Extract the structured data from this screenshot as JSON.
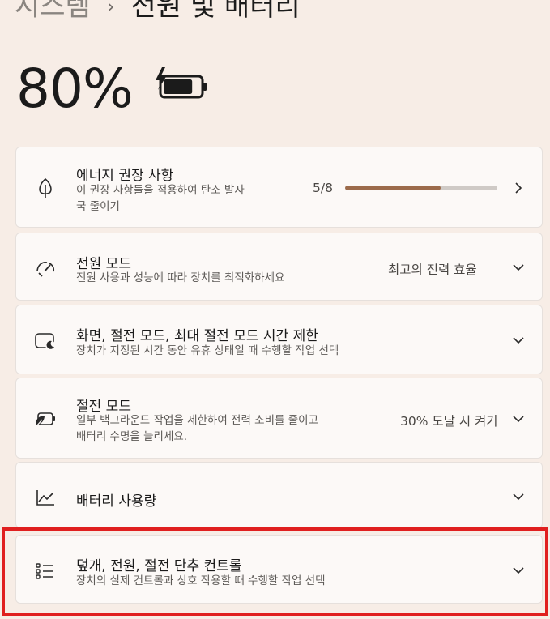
{
  "breadcrumb": {
    "parent": "시스템",
    "separator": "›",
    "current": "전원 및 배터리"
  },
  "battery": {
    "percent_text": "80%",
    "charging": true,
    "level": 0.8
  },
  "colors": {
    "accent": "#9c6b4b",
    "highlight": "#e01f1f",
    "background": "#f7ede6"
  },
  "cards": {
    "energy": {
      "title": "에너지 권장 사항",
      "desc_line1": "이 권장 사항들을 적용하여 탄소 발자",
      "desc_line2": "국 줄이기",
      "progress_text": "5/8",
      "progress_fraction": 0.625,
      "icon": "leaf-icon"
    },
    "power_mode": {
      "title": "전원 모드",
      "desc": "전원 사용과 성능에 따라 장치를 최적화하세요",
      "value": "최고의 전력 효율",
      "icon": "gauge-icon"
    },
    "screen_sleep": {
      "title": "화면, 절전 모드, 최대 절전 모드 시간 제한",
      "desc": "장치가 지정된 시간 동안 유휴 상태일 때 수행할 작업 선택",
      "icon": "screen-sleep-icon"
    },
    "saver": {
      "title": "절전 모드",
      "desc_line1": "일부 백그라운드 작업을 제한하여 전력 소비를 줄이고",
      "desc_line2": "배터리 수명을 늘리세요.",
      "value": "30% 도달 시 켜기",
      "icon": "battery-saver-icon"
    },
    "usage": {
      "title": "배터리 사용량",
      "icon": "chart-line-icon"
    },
    "lid": {
      "title": "덮개, 전원, 절전 단추 컨트롤",
      "desc": "장치의 실제 컨트롤과 상호 작용할 때 수행할 작업 선택",
      "icon": "list-icon"
    }
  }
}
